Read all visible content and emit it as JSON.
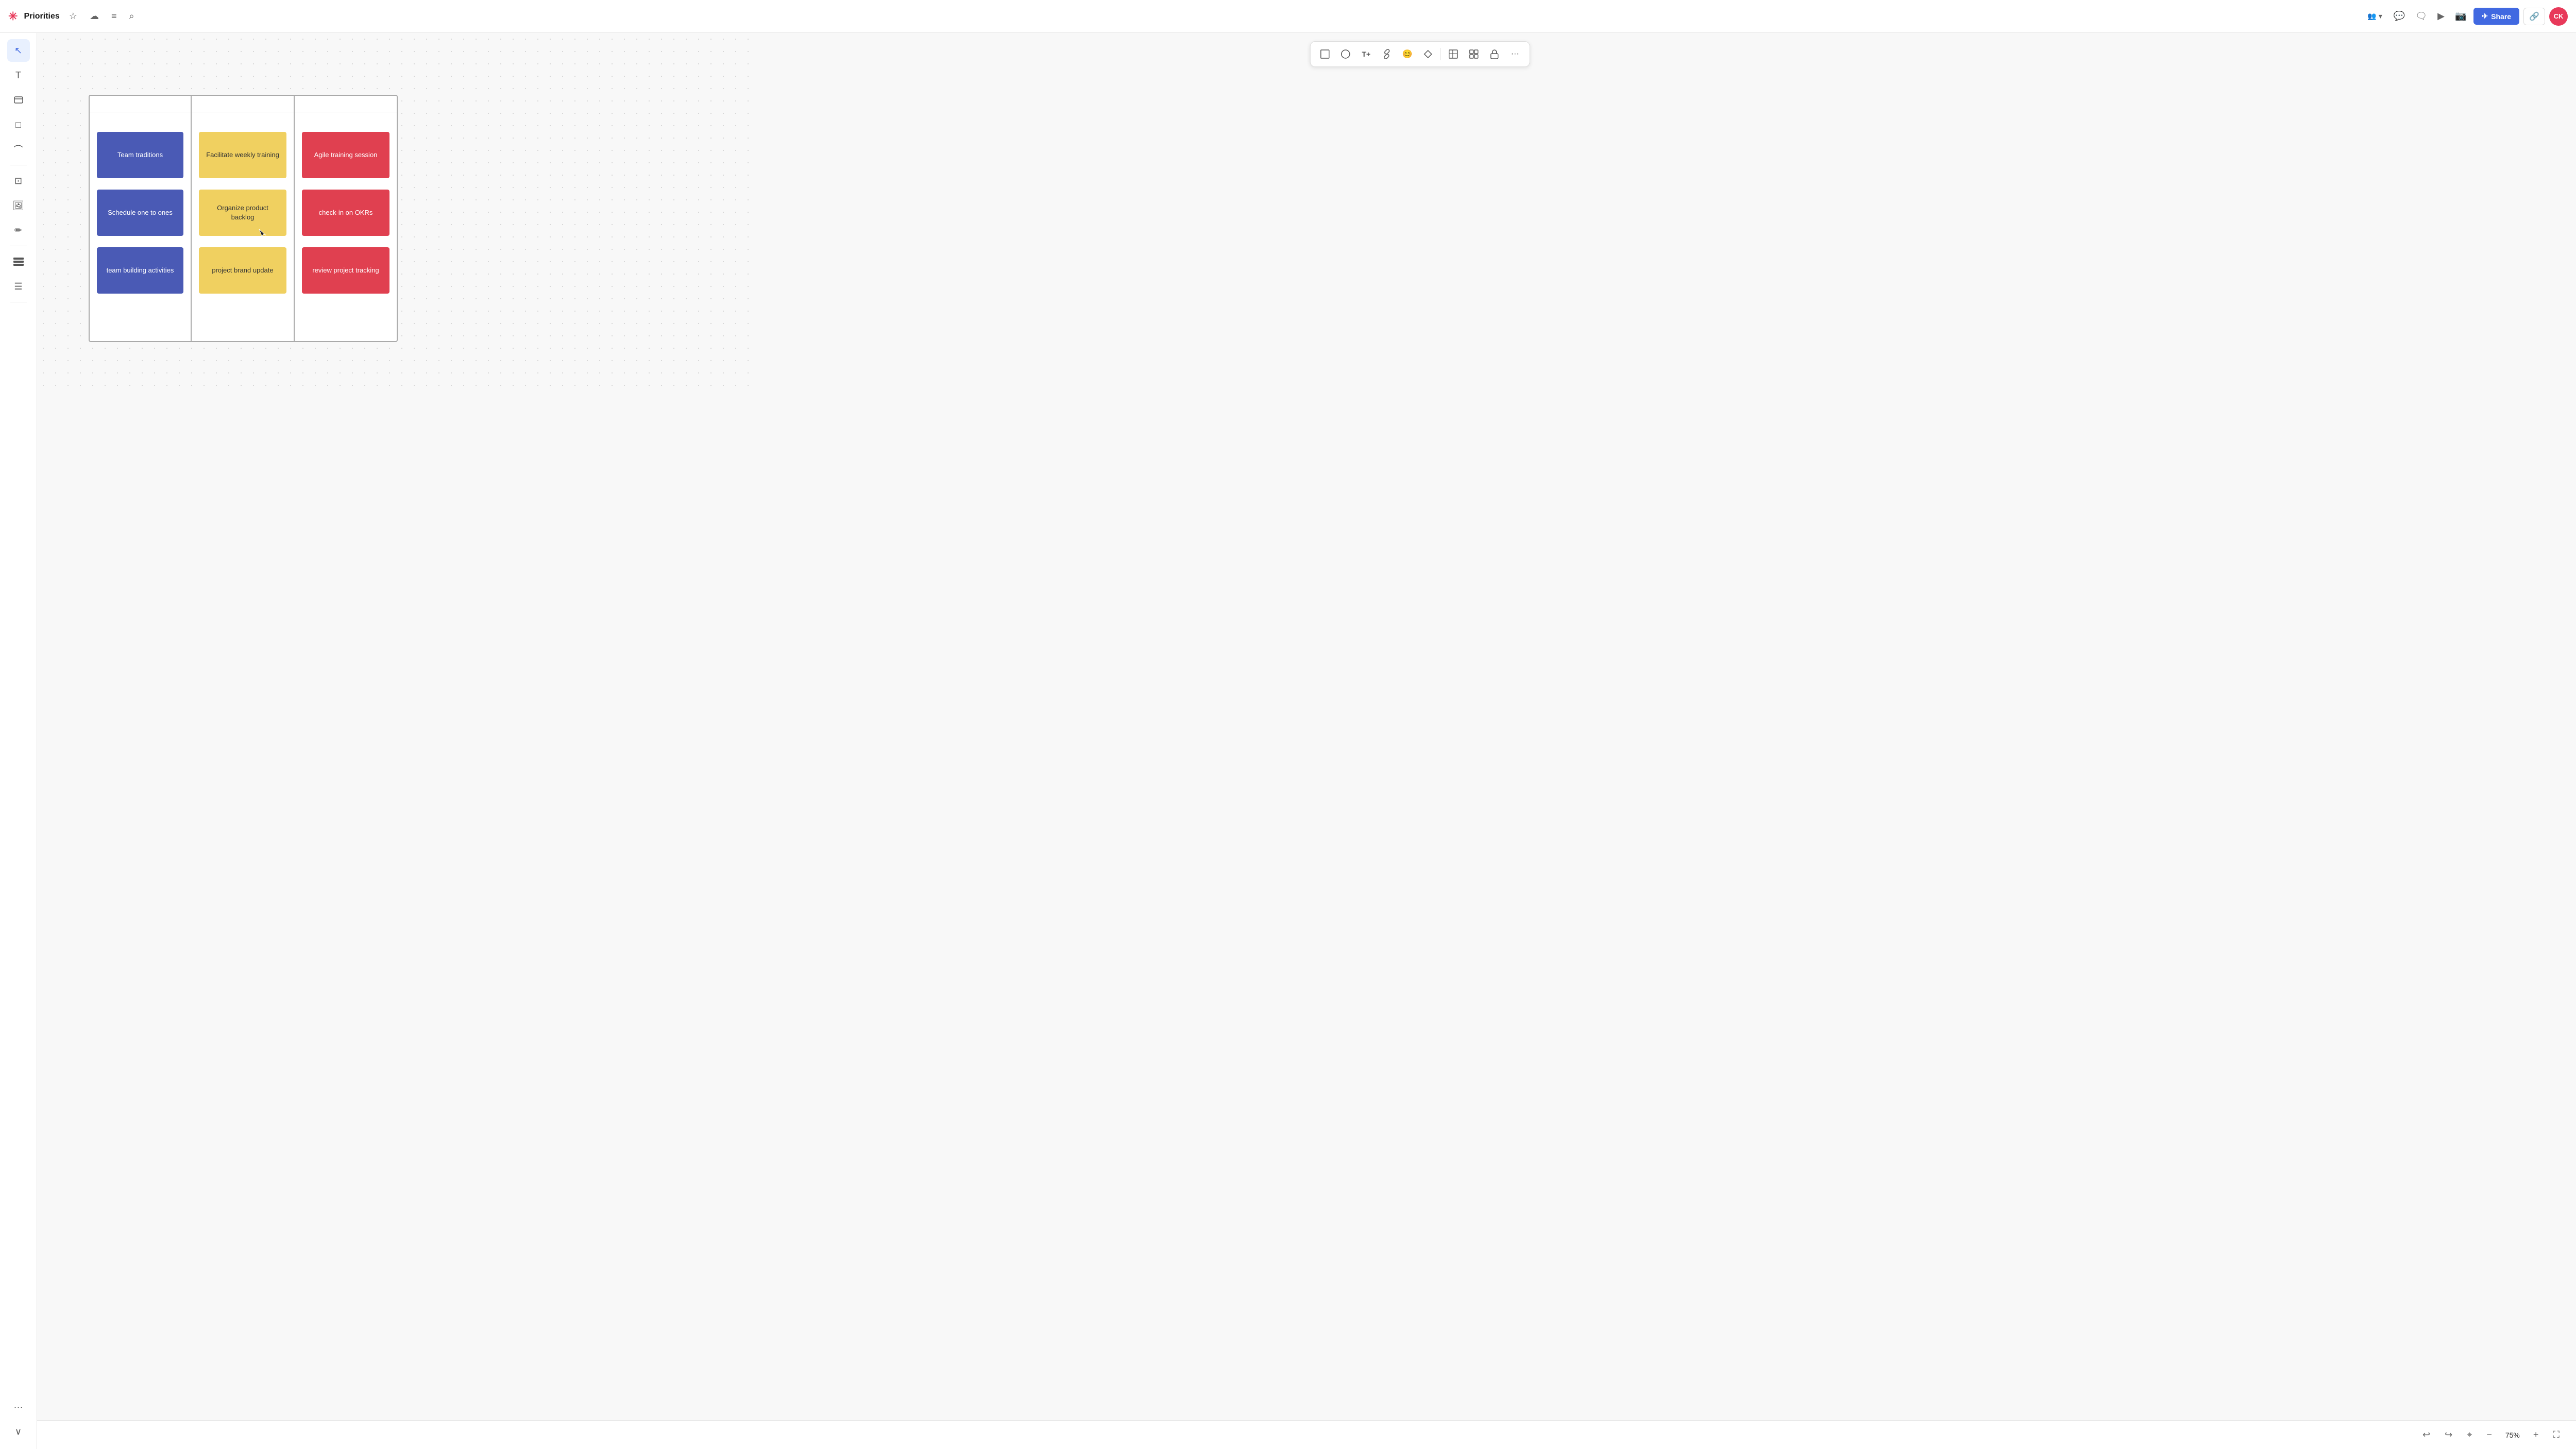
{
  "header": {
    "logo": "✳",
    "title": "Priorities",
    "share_label": "Share",
    "avatar_initials": "CK",
    "link_icon": "🔗",
    "share_icon": "✈"
  },
  "toolbar": {
    "items": [
      {
        "name": "square-outline",
        "icon": "□"
      },
      {
        "name": "circle-outline",
        "icon": "○"
      },
      {
        "name": "text-tool",
        "icon": "T+"
      },
      {
        "name": "link-tool",
        "icon": "⛓"
      },
      {
        "name": "emoji-tool",
        "icon": "😊"
      },
      {
        "name": "tag-tool",
        "icon": "🏷"
      },
      {
        "name": "table-tool",
        "icon": "▦"
      },
      {
        "name": "grid-tool",
        "icon": "⊞"
      },
      {
        "name": "lock-tool",
        "icon": "🔒"
      },
      {
        "name": "more-tool",
        "icon": "···"
      }
    ]
  },
  "sidebar": {
    "tools": [
      {
        "name": "select-tool",
        "icon": "↖",
        "active": true
      },
      {
        "name": "text-tool",
        "icon": "T"
      },
      {
        "name": "card-tool",
        "icon": "▭"
      },
      {
        "name": "frame-tool",
        "icon": "□"
      },
      {
        "name": "curve-tool",
        "icon": "⌒"
      },
      {
        "name": "crop-tool",
        "icon": "⊡"
      },
      {
        "name": "image-tool",
        "icon": "🖼"
      },
      {
        "name": "pen-tool",
        "icon": "✏"
      },
      {
        "name": "list-tool",
        "icon": "≡"
      },
      {
        "name": "lines-tool",
        "icon": "☰"
      },
      {
        "name": "wave-tool",
        "icon": "〜"
      },
      {
        "name": "more-tools",
        "icon": "···"
      },
      {
        "name": "collapse-btn",
        "icon": "∨"
      }
    ]
  },
  "board": {
    "columns": [
      {
        "id": "col1",
        "cards": [
          {
            "id": "c1",
            "text": "Team traditions",
            "color": "blue"
          },
          {
            "id": "c2",
            "text": "Schedule one to ones",
            "color": "blue"
          },
          {
            "id": "c3",
            "text": "team building activities",
            "color": "blue"
          }
        ]
      },
      {
        "id": "col2",
        "cards": [
          {
            "id": "c4",
            "text": "Facilitate weekly training",
            "color": "yellow"
          },
          {
            "id": "c5",
            "text": "Organize product backlog",
            "color": "yellow"
          },
          {
            "id": "c6",
            "text": "project brand update",
            "color": "yellow"
          }
        ]
      },
      {
        "id": "col3",
        "cards": [
          {
            "id": "c7",
            "text": "Agile training session",
            "color": "red"
          },
          {
            "id": "c8",
            "text": "check-in on OKRs",
            "color": "red"
          },
          {
            "id": "c9",
            "text": "review project tracking",
            "color": "red"
          }
        ]
      }
    ]
  },
  "bottomBar": {
    "undo_icon": "↩",
    "redo_icon": "↪",
    "home_icon": "⌖",
    "zoom_out_icon": "−",
    "zoom_level": "75%",
    "zoom_in_icon": "+",
    "fullscreen_icon": "⛶"
  }
}
